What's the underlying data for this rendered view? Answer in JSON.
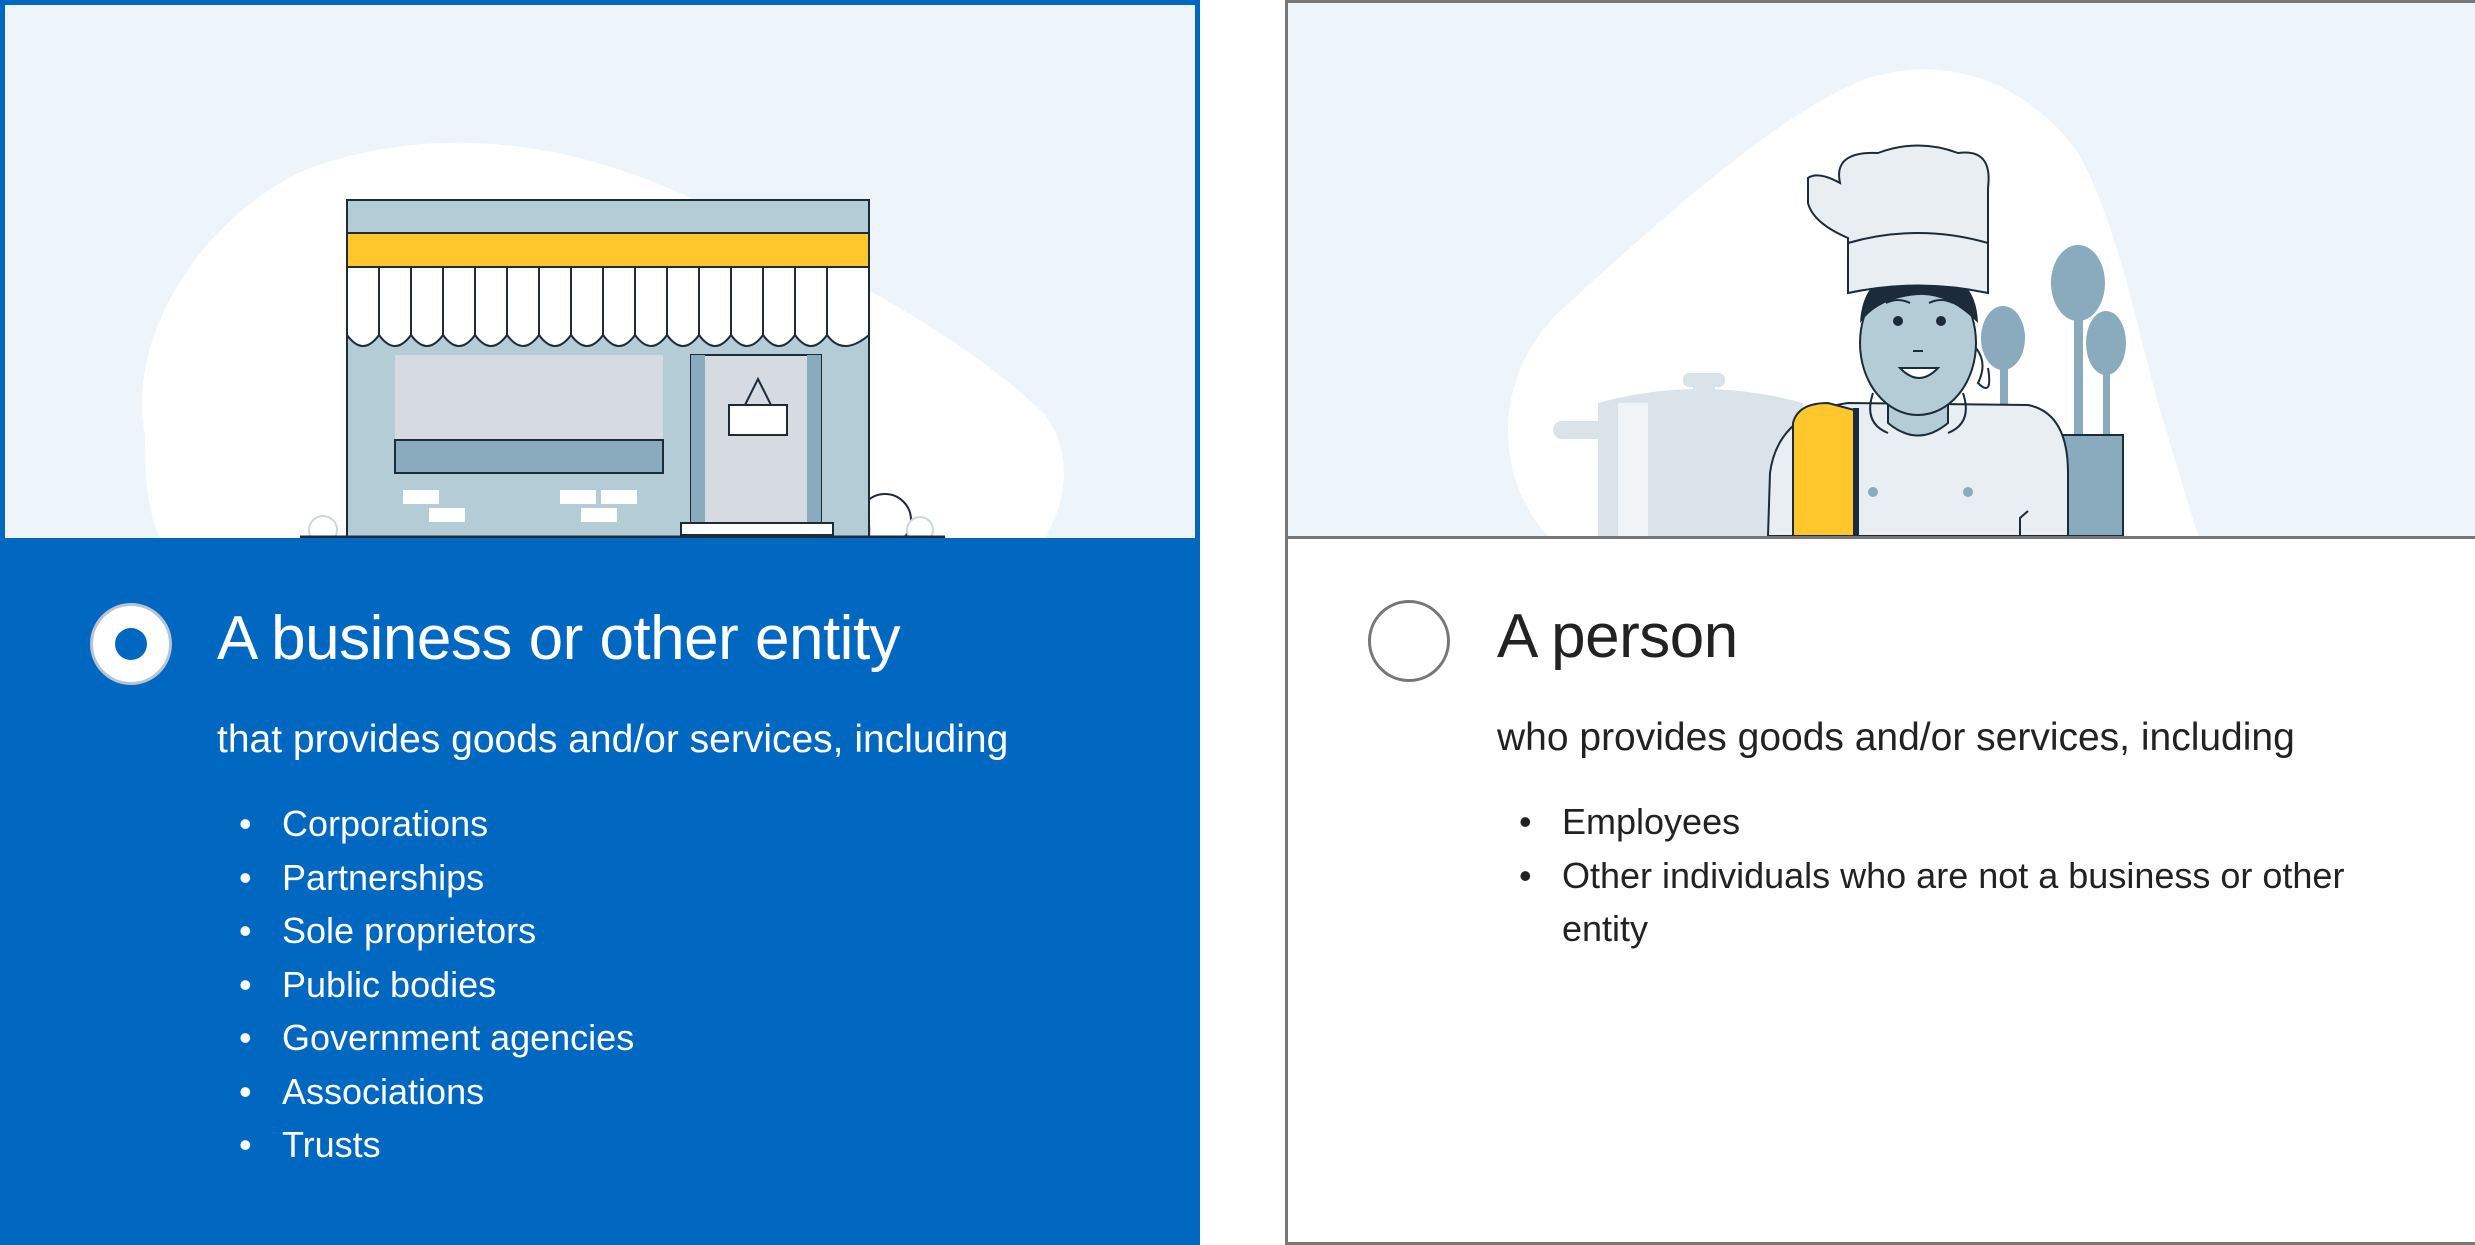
{
  "options": {
    "business": {
      "title": "A business or other entity",
      "subtitle": "that provides goods and/or services, including",
      "selected": true,
      "items": [
        "Corporations",
        "Partnerships",
        "Sole proprietors",
        "Public bodies",
        "Government agencies",
        "Associations",
        "Trusts"
      ]
    },
    "person": {
      "title": "A person",
      "subtitle": "who provides goods and/or services, including",
      "selected": false,
      "items": [
        "Employees",
        "Other individuals who are not a business or other entity"
      ]
    }
  },
  "colors": {
    "selected_bg": "#0068c0",
    "illustration_bg": "#edf5fb",
    "awning_yellow": "#ffc72c",
    "unselected_border": "#777777"
  }
}
